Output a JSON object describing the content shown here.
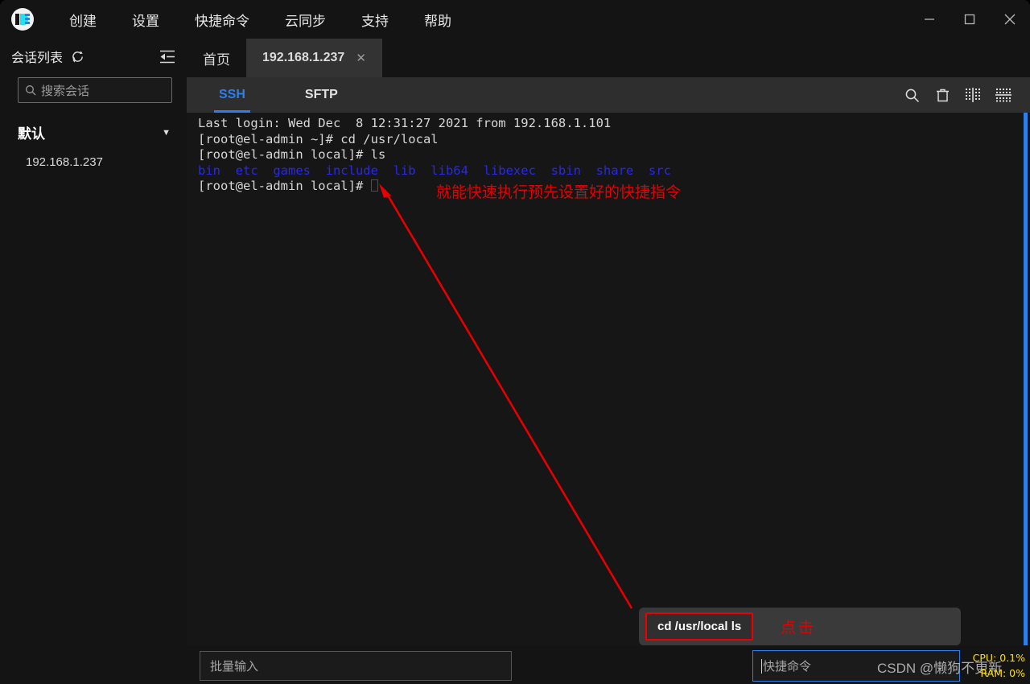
{
  "window": {
    "app_logo": "app-logo-icon",
    "controls": {
      "minimize": "–",
      "maximize": "□",
      "close": "✕"
    }
  },
  "menu": {
    "items": [
      {
        "label": "创建",
        "name": "create"
      },
      {
        "label": "设置",
        "name": "settings"
      },
      {
        "label": "快捷命令",
        "name": "quick-command"
      },
      {
        "label": "云同步",
        "name": "cloud-sync"
      },
      {
        "label": "支持",
        "name": "support"
      },
      {
        "label": "帮助",
        "name": "help"
      }
    ]
  },
  "sidebar": {
    "title": "会话列表",
    "refresh_icon": "refresh-icon",
    "collapse_icon": "collapse-panel-icon",
    "search": {
      "placeholder": "搜索会话",
      "value": "",
      "icon": "search-icon"
    },
    "group": {
      "name": "默认",
      "caret": "▼"
    },
    "sessions": [
      {
        "label": "192.168.1.237"
      }
    ]
  },
  "tabs": [
    {
      "label": "首页",
      "active": false,
      "closable": false
    },
    {
      "label": "192.168.1.237",
      "active": true,
      "closable": true,
      "close": "✕"
    }
  ],
  "subtabs": [
    {
      "label": "SSH",
      "active": true
    },
    {
      "label": "SFTP",
      "active": false
    }
  ],
  "toolbar_icons": [
    {
      "name": "search-icon"
    },
    {
      "name": "trash-icon"
    },
    {
      "name": "split-vertical-icon"
    },
    {
      "name": "split-horizontal-icon"
    }
  ],
  "terminal": {
    "lines": [
      {
        "segments": [
          {
            "text": "Last login: Wed Dec  8 12:31:27 2021 from 192.168.1.101",
            "color": "default"
          }
        ]
      },
      {
        "segments": [
          {
            "text": "[root@el-admin ~]# cd /usr/local",
            "color": "default"
          }
        ]
      },
      {
        "segments": [
          {
            "text": "[root@el-admin local]# ls",
            "color": "default"
          }
        ]
      },
      {
        "segments": [
          {
            "text": "bin  etc  games  include  lib  lib64  libexec  sbin  share  src",
            "color": "blue"
          }
        ]
      },
      {
        "segments": [
          {
            "text": "[root@el-admin local]# ",
            "color": "default"
          },
          {
            "text": "",
            "color": "cursor"
          }
        ]
      }
    ],
    "line1": "Last login: Wed Dec  8 12:31:27 2021 from 192.168.1.101",
    "line2": "[root@el-admin ~]# cd /usr/local",
    "line3": "[root@el-admin local]# ls",
    "line4": "bin  etc  games  include  lib  lib64  libexec  sbin  share  src",
    "line5": "[root@el-admin local]# "
  },
  "annotations": {
    "main_note": "就能快速执行预先设置好的快捷指令",
    "click_note": "点击",
    "arrow_color": "#e60000"
  },
  "quick_command_popup": {
    "items": [
      {
        "label": "cd /usr/local ls"
      }
    ]
  },
  "bottom": {
    "batch_input": {
      "placeholder": "批量输入",
      "value": ""
    },
    "quick_command_input": {
      "placeholder": "快捷命令",
      "value": ""
    },
    "cpu": "CPU: 0.1%",
    "ram": "RAM: 0%",
    "watermark": "CSDN @懒狗不更新"
  },
  "colors": {
    "accent": "#2f7fe8",
    "terminal_dir": "#2a2ae0",
    "annotation_red": "#e60000",
    "stat_yellow": "#ffe100"
  }
}
